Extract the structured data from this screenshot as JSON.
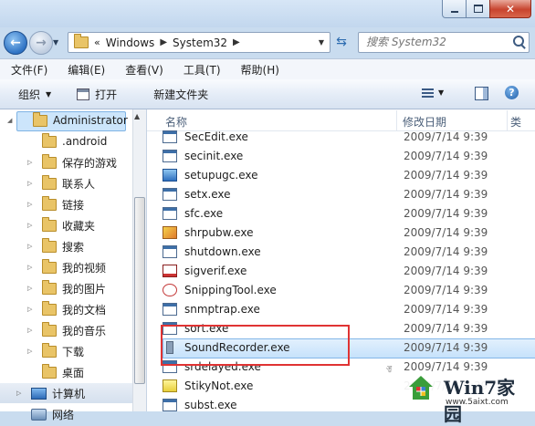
{
  "window": {
    "minimize_label": "—",
    "close_label": "✕"
  },
  "address": {
    "crumbs": [
      "Windows",
      "System32"
    ],
    "overflow_prefix": "«",
    "separator": "▶"
  },
  "search": {
    "placeholder": "搜索 System32"
  },
  "menu": [
    "文件(F)",
    "编辑(E)",
    "查看(V)",
    "工具(T)",
    "帮助(H)"
  ],
  "toolbar": {
    "organize": "组织",
    "open": "打开",
    "new_folder": "新建文件夹"
  },
  "columns": {
    "name": "名称",
    "modified": "修改日期",
    "more": "类"
  },
  "nav": {
    "selected": "Administrator",
    "items": [
      ".android",
      "保存的游戏",
      "联系人",
      "链接",
      "收藏夹",
      "搜索",
      "我的视频",
      "我的图片",
      "我的文档",
      "我的音乐",
      "下载",
      "桌面"
    ],
    "computer": "计算机",
    "network": "网络"
  },
  "files": [
    {
      "name": "SecEdit.exe",
      "date": "2009/7/14 9:39",
      "icon": "exe-icon"
    },
    {
      "name": "secinit.exe",
      "date": "2009/7/14 9:39",
      "icon": "exe-icon"
    },
    {
      "name": "setupugc.exe",
      "date": "2009/7/14 9:39",
      "icon": "setup-icon"
    },
    {
      "name": "setx.exe",
      "date": "2009/7/14 9:39",
      "icon": "exe-icon"
    },
    {
      "name": "sfc.exe",
      "date": "2009/7/14 9:39",
      "icon": "exe-icon"
    },
    {
      "name": "shrpubw.exe",
      "date": "2009/7/14 9:39",
      "icon": "share-icon"
    },
    {
      "name": "shutdown.exe",
      "date": "2009/7/14 9:39",
      "icon": "exe-icon"
    },
    {
      "name": "sigverif.exe",
      "date": "2009/7/14 9:39",
      "icon": "check-icon"
    },
    {
      "name": "SnippingTool.exe",
      "date": "2009/7/14 9:39",
      "icon": "scissors-icon"
    },
    {
      "name": "snmptrap.exe",
      "date": "2009/7/14 9:39",
      "icon": "exe-icon"
    },
    {
      "name": "sort.exe",
      "date": "2009/7/14 9:39",
      "icon": "exe-icon"
    },
    {
      "name": "SoundRecorder.exe",
      "date": "2009/7/14 9:39",
      "icon": "microphone-icon"
    },
    {
      "name": "srdelayed.exe",
      "date": "2009/7/14 9:39",
      "icon": "exe-icon"
    },
    {
      "name": "StikyNot.exe",
      "date": "2009/7/14 9:39",
      "icon": "note-icon"
    },
    {
      "name": "subst.exe",
      "date": "",
      "icon": "exe-icon"
    }
  ],
  "watermark": {
    "title": "Win7家园",
    "url": "www.5aixt.com"
  }
}
